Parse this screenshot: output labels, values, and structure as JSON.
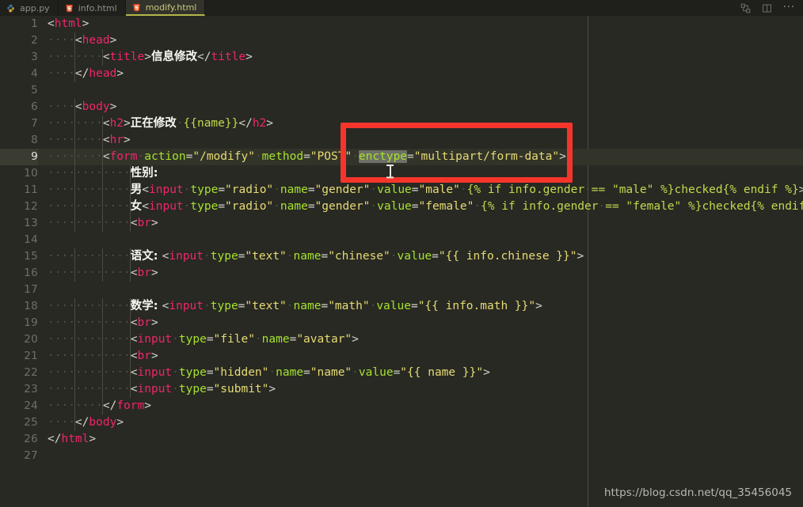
{
  "window": {
    "theme_background": "#282923",
    "accent_red": "#f5352b"
  },
  "tabbar": {
    "tabs": [
      {
        "label": "app.py",
        "icon": "python-file-icon",
        "active": false
      },
      {
        "label": "info.html",
        "icon": "html5-file-icon",
        "active": false
      },
      {
        "label": "modify.html",
        "icon": "html5-file-icon",
        "active": true
      }
    ],
    "tools": [
      {
        "name": "split-editor-icon",
        "label": ""
      },
      {
        "name": "toggle-panel-icon",
        "label": ""
      },
      {
        "name": "more-actions-icon",
        "label": "···"
      }
    ]
  },
  "editor": {
    "active_line": 9,
    "total_lines": 27,
    "selected_token": "enctype",
    "lines": [
      {
        "n": 1,
        "indent": 0,
        "tokens": [
          {
            "c": "punc",
            "t": "<"
          },
          {
            "c": "tag",
            "t": "html"
          },
          {
            "c": "punc",
            "t": ">"
          }
        ]
      },
      {
        "n": 2,
        "indent": 1,
        "tokens": [
          {
            "c": "ws",
            "t": "····"
          },
          {
            "c": "punc",
            "t": "<"
          },
          {
            "c": "tag",
            "t": "head"
          },
          {
            "c": "punc",
            "t": ">"
          }
        ]
      },
      {
        "n": 3,
        "indent": 2,
        "tokens": [
          {
            "c": "ws",
            "t": "········"
          },
          {
            "c": "punc",
            "t": "<"
          },
          {
            "c": "tag",
            "t": "title"
          },
          {
            "c": "punc",
            "t": ">"
          },
          {
            "c": "text",
            "t": "信息修改"
          },
          {
            "c": "punc",
            "t": "</"
          },
          {
            "c": "tag",
            "t": "title"
          },
          {
            "c": "punc",
            "t": ">"
          }
        ]
      },
      {
        "n": 4,
        "indent": 1,
        "tokens": [
          {
            "c": "ws",
            "t": "····"
          },
          {
            "c": "punc",
            "t": "</"
          },
          {
            "c": "tag",
            "t": "head"
          },
          {
            "c": "punc",
            "t": ">"
          }
        ]
      },
      {
        "n": 5,
        "indent": 0,
        "tokens": []
      },
      {
        "n": 6,
        "indent": 1,
        "tokens": [
          {
            "c": "ws",
            "t": "····"
          },
          {
            "c": "punc",
            "t": "<"
          },
          {
            "c": "tag",
            "t": "body"
          },
          {
            "c": "punc",
            "t": ">"
          }
        ]
      },
      {
        "n": 7,
        "indent": 2,
        "tokens": [
          {
            "c": "ws",
            "t": "········"
          },
          {
            "c": "punc",
            "t": "<"
          },
          {
            "c": "tag",
            "t": "h2"
          },
          {
            "c": "punc",
            "t": ">"
          },
          {
            "c": "text",
            "t": "正在修改"
          },
          {
            "c": "ws",
            "t": "·"
          },
          {
            "c": "tmpl",
            "t": "{{name}}"
          },
          {
            "c": "punc",
            "t": "</"
          },
          {
            "c": "tag",
            "t": "h2"
          },
          {
            "c": "punc",
            "t": ">"
          }
        ]
      },
      {
        "n": 8,
        "indent": 2,
        "tokens": [
          {
            "c": "ws",
            "t": "········"
          },
          {
            "c": "punc",
            "t": "<"
          },
          {
            "c": "tag",
            "t": "hr"
          },
          {
            "c": "punc",
            "t": ">"
          }
        ]
      },
      {
        "n": 9,
        "indent": 2,
        "tokens": [
          {
            "c": "ws",
            "t": "········"
          },
          {
            "c": "punc",
            "t": "<"
          },
          {
            "c": "tag",
            "t": "form"
          },
          {
            "c": "ws",
            "t": "·"
          },
          {
            "c": "attr",
            "t": "action"
          },
          {
            "c": "op",
            "t": "="
          },
          {
            "c": "str",
            "t": "\"/modify\""
          },
          {
            "c": "ws",
            "t": "·"
          },
          {
            "c": "attr",
            "t": "method"
          },
          {
            "c": "op",
            "t": "="
          },
          {
            "c": "str",
            "t": "\"POST\""
          },
          {
            "c": "ws",
            "t": "·"
          },
          {
            "c": "sel",
            "t": "enctype"
          },
          {
            "c": "op",
            "t": "="
          },
          {
            "c": "str",
            "t": "\"multipart/form-data\""
          },
          {
            "c": "punc",
            "t": ">"
          }
        ]
      },
      {
        "n": 10,
        "indent": 3,
        "tokens": [
          {
            "c": "ws",
            "t": "············"
          },
          {
            "c": "text",
            "t": "性别:"
          }
        ]
      },
      {
        "n": 11,
        "indent": 3,
        "tokens": [
          {
            "c": "ws",
            "t": "············"
          },
          {
            "c": "text",
            "t": "男"
          },
          {
            "c": "punc",
            "t": "<"
          },
          {
            "c": "tag",
            "t": "input"
          },
          {
            "c": "ws",
            "t": "·"
          },
          {
            "c": "attr",
            "t": "type"
          },
          {
            "c": "op",
            "t": "="
          },
          {
            "c": "str",
            "t": "\"radio\""
          },
          {
            "c": "ws",
            "t": "·"
          },
          {
            "c": "attr",
            "t": "name"
          },
          {
            "c": "op",
            "t": "="
          },
          {
            "c": "str",
            "t": "\"gender\""
          },
          {
            "c": "ws",
            "t": "·"
          },
          {
            "c": "attr",
            "t": "value"
          },
          {
            "c": "op",
            "t": "="
          },
          {
            "c": "str",
            "t": "\"male\""
          },
          {
            "c": "ws",
            "t": "·"
          },
          {
            "c": "tmpl",
            "t": "{% if info.gender"
          },
          {
            "c": "ws",
            "t": "·"
          },
          {
            "c": "tmpl",
            "t": "== \"male\" %}checked{% endif %}"
          },
          {
            "c": "punc",
            "t": ">"
          }
        ]
      },
      {
        "n": 12,
        "indent": 3,
        "tokens": [
          {
            "c": "ws",
            "t": "············"
          },
          {
            "c": "text",
            "t": "女"
          },
          {
            "c": "punc",
            "t": "<"
          },
          {
            "c": "tag",
            "t": "input"
          },
          {
            "c": "ws",
            "t": "·"
          },
          {
            "c": "attr",
            "t": "type"
          },
          {
            "c": "op",
            "t": "="
          },
          {
            "c": "str",
            "t": "\"radio\""
          },
          {
            "c": "ws",
            "t": "·"
          },
          {
            "c": "attr",
            "t": "name"
          },
          {
            "c": "op",
            "t": "="
          },
          {
            "c": "str",
            "t": "\"gender\""
          },
          {
            "c": "ws",
            "t": "·"
          },
          {
            "c": "attr",
            "t": "value"
          },
          {
            "c": "op",
            "t": "="
          },
          {
            "c": "str",
            "t": "\"female\""
          },
          {
            "c": "ws",
            "t": "·"
          },
          {
            "c": "tmpl",
            "t": "{% if info.gender"
          },
          {
            "c": "ws",
            "t": "·"
          },
          {
            "c": "tmpl",
            "t": "== \"female\" %}checked{% endif %}"
          },
          {
            "c": "punc",
            "t": ">"
          }
        ]
      },
      {
        "n": 13,
        "indent": 3,
        "tokens": [
          {
            "c": "ws",
            "t": "············"
          },
          {
            "c": "punc",
            "t": "<"
          },
          {
            "c": "tag",
            "t": "br"
          },
          {
            "c": "punc",
            "t": ">"
          }
        ]
      },
      {
        "n": 14,
        "indent": 0,
        "tokens": []
      },
      {
        "n": 15,
        "indent": 3,
        "tokens": [
          {
            "c": "ws",
            "t": "············"
          },
          {
            "c": "text",
            "t": "语文: "
          },
          {
            "c": "punc",
            "t": "<"
          },
          {
            "c": "tag",
            "t": "input"
          },
          {
            "c": "ws",
            "t": "·"
          },
          {
            "c": "attr",
            "t": "type"
          },
          {
            "c": "op",
            "t": "="
          },
          {
            "c": "str",
            "t": "\"text\""
          },
          {
            "c": "ws",
            "t": "·"
          },
          {
            "c": "attr",
            "t": "name"
          },
          {
            "c": "op",
            "t": "="
          },
          {
            "c": "str",
            "t": "\"chinese\""
          },
          {
            "c": "ws",
            "t": "·"
          },
          {
            "c": "attr",
            "t": "value"
          },
          {
            "c": "op",
            "t": "="
          },
          {
            "c": "str",
            "t": "\"{{ info.chinese }}\""
          },
          {
            "c": "punc",
            "t": ">"
          }
        ]
      },
      {
        "n": 16,
        "indent": 3,
        "tokens": [
          {
            "c": "ws",
            "t": "············"
          },
          {
            "c": "punc",
            "t": "<"
          },
          {
            "c": "tag",
            "t": "br"
          },
          {
            "c": "punc",
            "t": ">"
          }
        ]
      },
      {
        "n": 17,
        "indent": 0,
        "tokens": []
      },
      {
        "n": 18,
        "indent": 3,
        "tokens": [
          {
            "c": "ws",
            "t": "············"
          },
          {
            "c": "text",
            "t": "数学: "
          },
          {
            "c": "punc",
            "t": "<"
          },
          {
            "c": "tag",
            "t": "input"
          },
          {
            "c": "ws",
            "t": "·"
          },
          {
            "c": "attr",
            "t": "type"
          },
          {
            "c": "op",
            "t": "="
          },
          {
            "c": "str",
            "t": "\"text\""
          },
          {
            "c": "ws",
            "t": "·"
          },
          {
            "c": "attr",
            "t": "name"
          },
          {
            "c": "op",
            "t": "="
          },
          {
            "c": "str",
            "t": "\"math\""
          },
          {
            "c": "ws",
            "t": "·"
          },
          {
            "c": "attr",
            "t": "value"
          },
          {
            "c": "op",
            "t": "="
          },
          {
            "c": "str",
            "t": "\"{{ info.math }}\""
          },
          {
            "c": "punc",
            "t": ">"
          }
        ]
      },
      {
        "n": 19,
        "indent": 3,
        "tokens": [
          {
            "c": "ws",
            "t": "············"
          },
          {
            "c": "punc",
            "t": "<"
          },
          {
            "c": "tag",
            "t": "br"
          },
          {
            "c": "punc",
            "t": ">"
          }
        ]
      },
      {
        "n": 20,
        "indent": 3,
        "tokens": [
          {
            "c": "ws",
            "t": "············"
          },
          {
            "c": "punc",
            "t": "<"
          },
          {
            "c": "tag",
            "t": "input"
          },
          {
            "c": "ws",
            "t": "·"
          },
          {
            "c": "attr",
            "t": "type"
          },
          {
            "c": "op",
            "t": "="
          },
          {
            "c": "str",
            "t": "\"file\""
          },
          {
            "c": "ws",
            "t": "·"
          },
          {
            "c": "attr",
            "t": "name"
          },
          {
            "c": "op",
            "t": "="
          },
          {
            "c": "str",
            "t": "\"avatar\""
          },
          {
            "c": "punc",
            "t": ">"
          }
        ]
      },
      {
        "n": 21,
        "indent": 3,
        "tokens": [
          {
            "c": "ws",
            "t": "············"
          },
          {
            "c": "punc",
            "t": "<"
          },
          {
            "c": "tag",
            "t": "br"
          },
          {
            "c": "punc",
            "t": ">"
          }
        ]
      },
      {
        "n": 22,
        "indent": 3,
        "tokens": [
          {
            "c": "ws",
            "t": "············"
          },
          {
            "c": "punc",
            "t": "<"
          },
          {
            "c": "tag",
            "t": "input"
          },
          {
            "c": "ws",
            "t": "·"
          },
          {
            "c": "attr",
            "t": "type"
          },
          {
            "c": "op",
            "t": "="
          },
          {
            "c": "str",
            "t": "\"hidden\""
          },
          {
            "c": "ws",
            "t": "·"
          },
          {
            "c": "attr",
            "t": "name"
          },
          {
            "c": "op",
            "t": "="
          },
          {
            "c": "str",
            "t": "\"name\""
          },
          {
            "c": "ws",
            "t": "·"
          },
          {
            "c": "attr",
            "t": "value"
          },
          {
            "c": "op",
            "t": "="
          },
          {
            "c": "str",
            "t": "\"{{ name }}\""
          },
          {
            "c": "punc",
            "t": ">"
          }
        ]
      },
      {
        "n": 23,
        "indent": 3,
        "tokens": [
          {
            "c": "ws",
            "t": "············"
          },
          {
            "c": "punc",
            "t": "<"
          },
          {
            "c": "tag",
            "t": "input"
          },
          {
            "c": "ws",
            "t": "·"
          },
          {
            "c": "attr",
            "t": "type"
          },
          {
            "c": "op",
            "t": "="
          },
          {
            "c": "str",
            "t": "\"submit\""
          },
          {
            "c": "punc",
            "t": ">"
          }
        ]
      },
      {
        "n": 24,
        "indent": 2,
        "tokens": [
          {
            "c": "ws",
            "t": "········"
          },
          {
            "c": "punc",
            "t": "</"
          },
          {
            "c": "tag",
            "t": "form"
          },
          {
            "c": "punc",
            "t": ">"
          }
        ]
      },
      {
        "n": 25,
        "indent": 1,
        "tokens": [
          {
            "c": "ws",
            "t": "····"
          },
          {
            "c": "punc",
            "t": "</"
          },
          {
            "c": "tag",
            "t": "body"
          },
          {
            "c": "punc",
            "t": ">"
          }
        ]
      },
      {
        "n": 26,
        "indent": 0,
        "tokens": [
          {
            "c": "punc",
            "t": "</"
          },
          {
            "c": "tag",
            "t": "html"
          },
          {
            "c": "punc",
            "t": ">"
          }
        ]
      },
      {
        "n": 27,
        "indent": 0,
        "tokens": []
      }
    ]
  },
  "annotation": {
    "name": "red-highlight-box",
    "color": "#f5352b",
    "targets": "enctype=\"multipart/form-data\""
  },
  "watermark": {
    "text": "https://blog.csdn.net/qq_35456045"
  }
}
